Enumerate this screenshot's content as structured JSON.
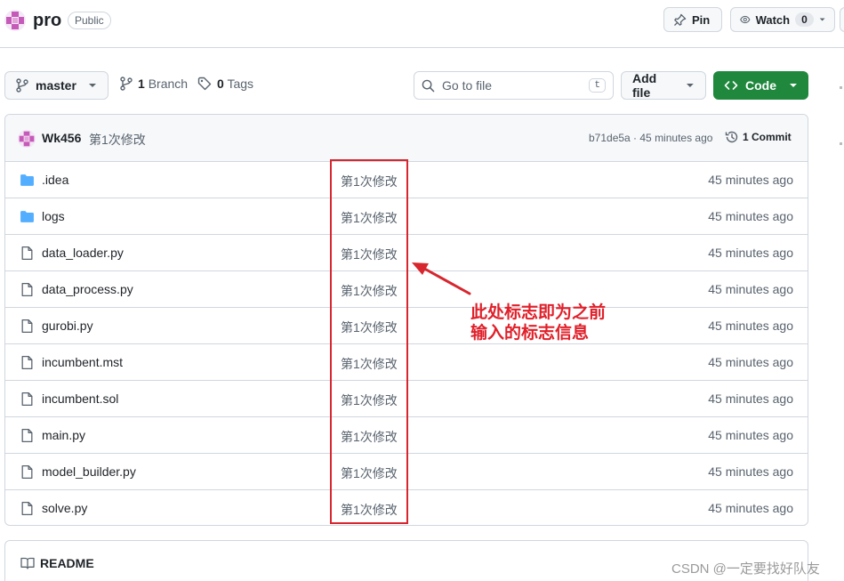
{
  "repo": {
    "name": "pro",
    "visibility": "Public",
    "pin_label": "Pin",
    "watch_label": "Watch",
    "watch_count": "0"
  },
  "toolbar": {
    "branch": "master",
    "branch_count": "1",
    "branch_label": "Branch",
    "tag_count": "0",
    "tag_label": "Tags",
    "go_to_file_placeholder": "Go to file",
    "go_to_file_shortcut": "t",
    "add_file_label": "Add file",
    "code_label": "Code"
  },
  "commit": {
    "author": "Wk456",
    "message": "第1次修改",
    "meta": "b71de5a · 45 minutes ago",
    "count_label": "1 Commit"
  },
  "files": [
    {
      "name": ".idea",
      "type": "folder",
      "message": "第1次修改",
      "time": "45 minutes ago"
    },
    {
      "name": "logs",
      "type": "folder",
      "message": "第1次修改",
      "time": "45 minutes ago"
    },
    {
      "name": "data_loader.py",
      "type": "file",
      "message": "第1次修改",
      "time": "45 minutes ago"
    },
    {
      "name": "data_process.py",
      "type": "file",
      "message": "第1次修改",
      "time": "45 minutes ago"
    },
    {
      "name": "gurobi.py",
      "type": "file",
      "message": "第1次修改",
      "time": "45 minutes ago"
    },
    {
      "name": "incumbent.mst",
      "type": "file",
      "message": "第1次修改",
      "time": "45 minutes ago"
    },
    {
      "name": "incumbent.sol",
      "type": "file",
      "message": "第1次修改",
      "time": "45 minutes ago"
    },
    {
      "name": "main.py",
      "type": "file",
      "message": "第1次修改",
      "time": "45 minutes ago"
    },
    {
      "name": "model_builder.py",
      "type": "file",
      "message": "第1次修改",
      "time": "45 minutes ago"
    },
    {
      "name": "solve.py",
      "type": "file",
      "message": "第1次修改",
      "time": "45 minutes ago"
    }
  ],
  "readme": {
    "label": "README"
  },
  "annotation": {
    "line1": "此处标志即为之前",
    "line2": "输入的标志信息",
    "color": "#e0202a"
  },
  "watermark": "CSDN @一定要找好队友",
  "colors": {
    "accent_green": "#1f883d",
    "folder_blue": "#54aeff",
    "border": "#d0d7de",
    "muted_text": "#59636e"
  }
}
